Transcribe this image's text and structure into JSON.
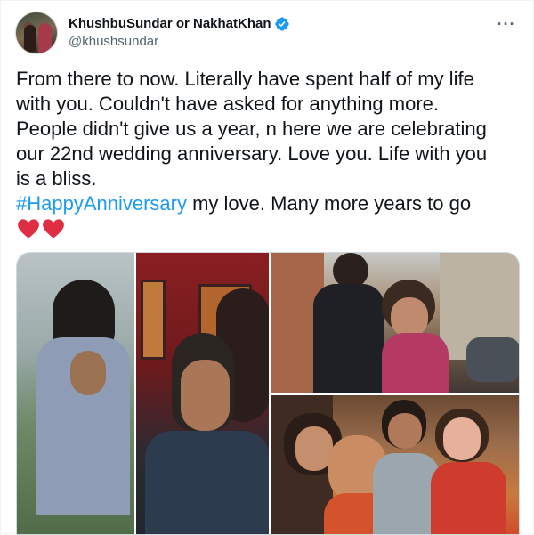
{
  "author": {
    "display_name": "KhushbuSundar or NakhatKhan",
    "handle": "@khushsundar",
    "verified_icon": "verified-badge-icon",
    "accent_color": "#1d9bf0"
  },
  "menu": {
    "icon": "more-options-icon",
    "glyph": "···"
  },
  "tweet": {
    "lines": [
      "From there to now. Literally have spent half of my life",
      "with you. Couldn't have asked for anything more.",
      "People didn't give us a year, n here we are celebrating",
      "our 22nd wedding anniversary. Love you. Life with you",
      "is a bliss."
    ],
    "hashtag": "#HappyAnniversary",
    "after_hashtag": " my love. Many more years to go",
    "emoji": [
      "red-heart-icon",
      "red-heart-icon"
    ]
  },
  "media": {
    "photos": [
      {
        "name": "photo-1",
        "description_icon": "photo"
      },
      {
        "name": "photo-2",
        "description_icon": "photo"
      },
      {
        "name": "photo-3",
        "description_icon": "photo"
      },
      {
        "name": "photo-4",
        "description_icon": "photo"
      }
    ]
  }
}
